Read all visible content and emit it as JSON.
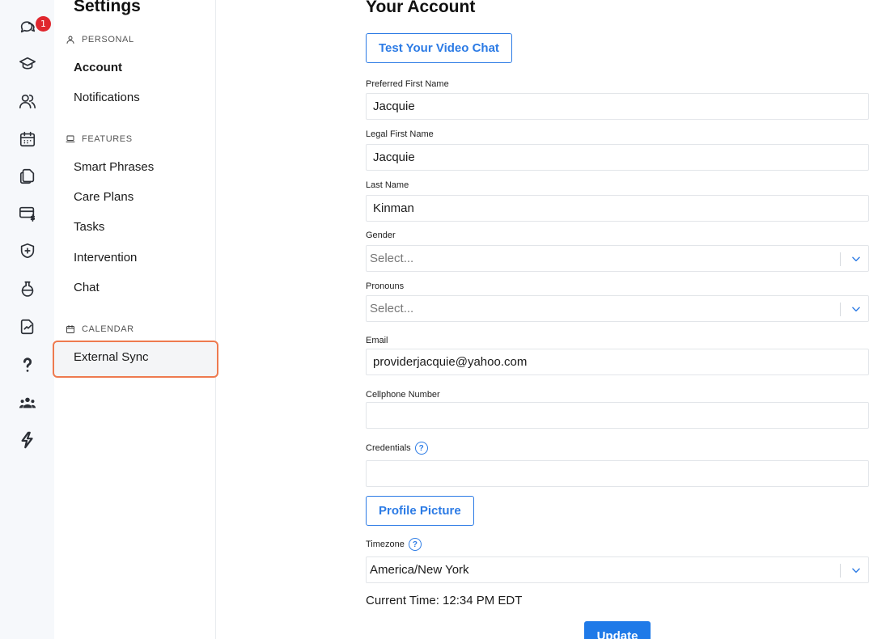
{
  "rail": {
    "messages_badge": "1",
    "items": [
      "messages-icon",
      "graduation-cap-icon",
      "users-icon",
      "calendar-icon",
      "documents-icon",
      "billing-icon",
      "shield-icon",
      "lab-flask-icon",
      "chart-document-icon",
      "help-icon",
      "team-icon",
      "lightning-icon"
    ]
  },
  "sidebar": {
    "title": "Settings",
    "sections": [
      {
        "label": "PERSONAL",
        "icon": "user-icon",
        "items": [
          "Account",
          "Notifications"
        ]
      },
      {
        "label": "FEATURES",
        "icon": "laptop-icon",
        "items": [
          "Smart Phrases",
          "Care Plans",
          "Tasks",
          "Intervention",
          "Chat"
        ]
      },
      {
        "label": "CALENDAR",
        "icon": "calendar-icon",
        "items": [
          "External Sync"
        ]
      }
    ],
    "active_item": "External Sync",
    "bold_item": "Account"
  },
  "main": {
    "title": "Your Account",
    "test_video_button": "Test Your Video Chat",
    "fields": {
      "preferred_first_name": {
        "label": "Preferred First Name",
        "value": "Jacquie"
      },
      "legal_first_name": {
        "label": "Legal First Name",
        "value": "Jacquie"
      },
      "last_name": {
        "label": "Last Name",
        "value": "Kinman"
      },
      "gender": {
        "label": "Gender",
        "placeholder": "Select..."
      },
      "pronouns": {
        "label": "Pronouns",
        "placeholder": "Select..."
      },
      "email": {
        "label": "Email",
        "value": "providerjacquie@yahoo.com"
      },
      "cellphone": {
        "label": "Cellphone Number",
        "value": ""
      },
      "credentials": {
        "label": "Credentials",
        "value": "",
        "help": "?"
      },
      "timezone": {
        "label": "Timezone",
        "value": "America/New York",
        "help": "?"
      }
    },
    "profile_picture_button": "Profile Picture",
    "current_time": "Current Time: 12:34 PM EDT",
    "update_button": "Update"
  },
  "colors": {
    "accent": "#2c7be5",
    "badge": "#e0262d",
    "selected_border": "#ee7a4f"
  }
}
